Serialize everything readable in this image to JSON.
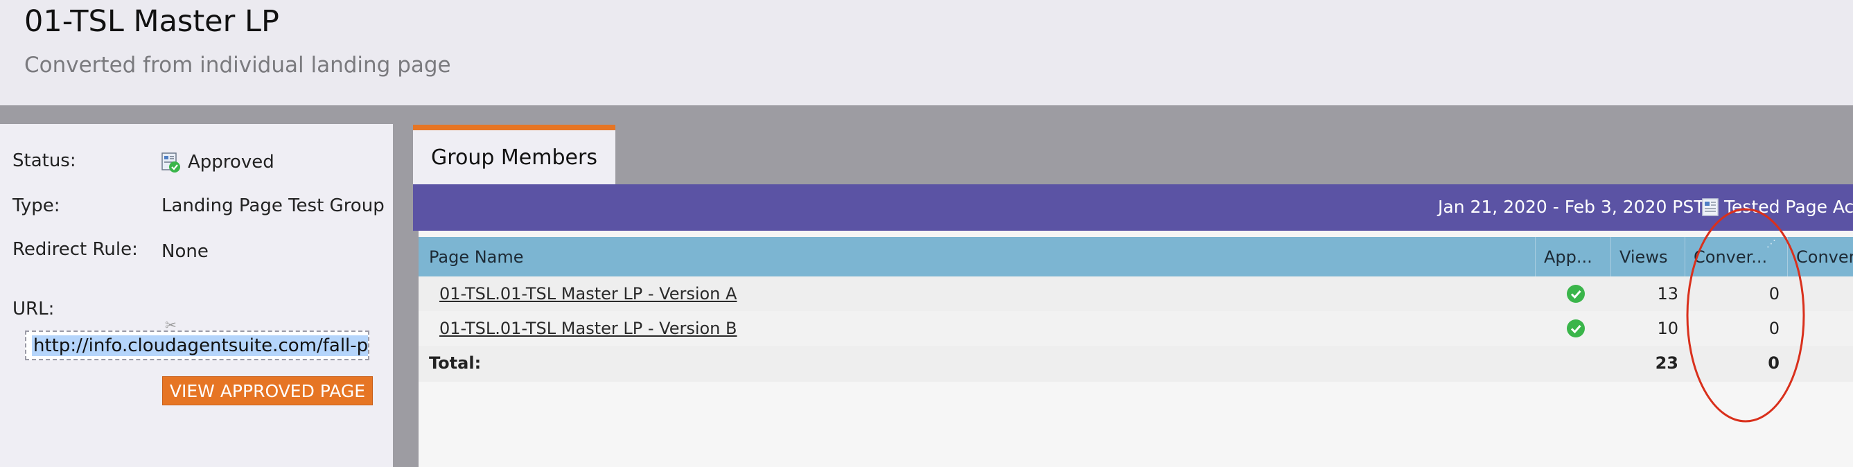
{
  "header": {
    "title": "01-TSL Master LP",
    "subtitle": "Converted from individual landing page"
  },
  "details": {
    "status_label": "Status:",
    "status_value": "Approved",
    "type_label": "Type:",
    "type_value": "Landing Page Test Group",
    "redirect_label": "Redirect Rule:",
    "redirect_value": "None",
    "url_label": "URL:",
    "url_value": "http://info.cloudagentsuite.com/fall-pron",
    "view_button": "VIEW APPROVED PAGE"
  },
  "tabs": [
    {
      "label": "Group Members",
      "active": true
    }
  ],
  "toolbar": {
    "date_range": "Jan 21, 2020 - Feb 3, 2020 PST",
    "tested_actions": "Tested Page Actio"
  },
  "grid": {
    "columns": [
      "Page Name",
      "App...",
      "Views",
      "Conver...",
      "Conver"
    ],
    "rows": [
      {
        "name": "01-TSL.01-TSL Master LP - Version A",
        "approved": true,
        "views": "13",
        "conversions": "0"
      },
      {
        "name": "01-TSL.01-TSL Master LP - Version B",
        "approved": true,
        "views": "10",
        "conversions": "0"
      }
    ],
    "total": {
      "label": "Total:",
      "views": "23",
      "conversions": "0"
    }
  },
  "colors": {
    "accent_orange": "#e67524",
    "toolbar_purple": "#5b53a4",
    "grid_header_blue": "#7cb5d2",
    "check_green": "#3ab54a",
    "annotation_red": "#d9301c"
  },
  "icons": {
    "status": "approved-page-icon",
    "approved_check": "check-circle-icon",
    "tested_actions": "page-actions-icon"
  }
}
